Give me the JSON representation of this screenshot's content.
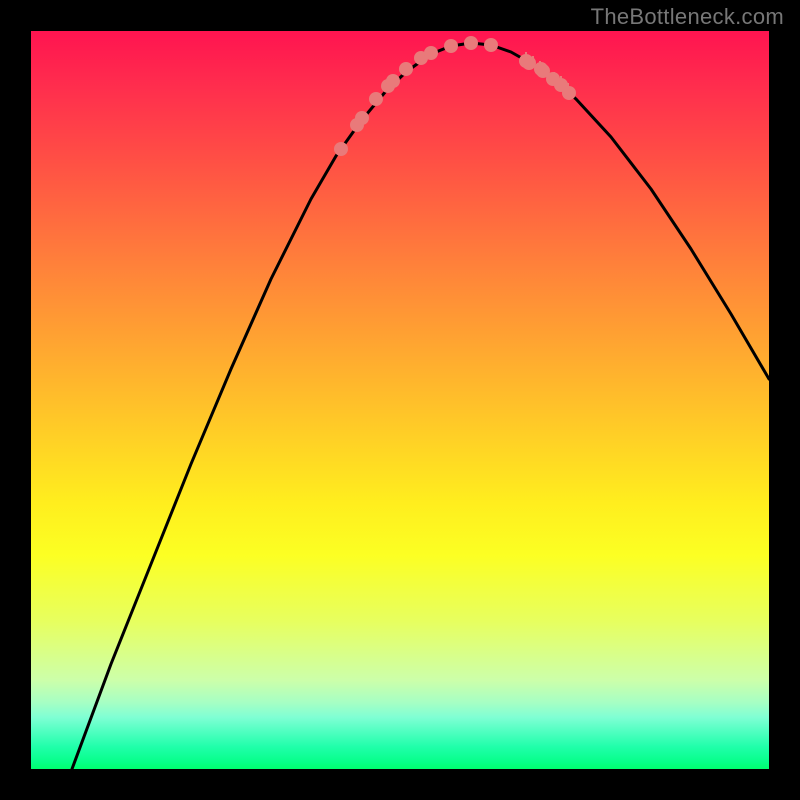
{
  "watermark": "TheBottleneck.com",
  "chart_data": {
    "type": "line",
    "title": "",
    "xlabel": "",
    "ylabel": "",
    "xlim": [
      0,
      738
    ],
    "ylim": [
      0,
      738
    ],
    "grid": false,
    "series": [
      {
        "name": "curve",
        "color": "#000000",
        "x": [
          41,
          80,
          120,
          160,
          200,
          240,
          280,
          305,
          330,
          355,
          375,
          400,
          420,
          440,
          460,
          480,
          510,
          545,
          580,
          620,
          660,
          700,
          738
        ],
        "y": [
          0,
          105,
          205,
          305,
          400,
          490,
          570,
          613,
          648,
          678,
          697,
          715,
          723,
          726,
          724,
          717,
          700,
          670,
          632,
          580,
          520,
          455,
          390
        ]
      }
    ],
    "markers": {
      "name": "dots",
      "color": "#e97a7a",
      "radius": 7,
      "points": [
        [
          310,
          620
        ],
        [
          326,
          644
        ],
        [
          331,
          651
        ],
        [
          345,
          670
        ],
        [
          357,
          683
        ],
        [
          362,
          688
        ],
        [
          375,
          700
        ],
        [
          390,
          711
        ],
        [
          400,
          716
        ],
        [
          420,
          723
        ],
        [
          440,
          726
        ],
        [
          460,
          724
        ],
        [
          495,
          708
        ],
        [
          498,
          706
        ],
        [
          510,
          700
        ],
        [
          512,
          698
        ],
        [
          522,
          690
        ],
        [
          530,
          684
        ],
        [
          538,
          676
        ]
      ],
      "ticks": [
        [
          495,
          708
        ],
        [
          502,
          704
        ],
        [
          509,
          699
        ],
        [
          516,
          694
        ],
        [
          523,
          688
        ],
        [
          530,
          684
        ],
        [
          537,
          677
        ]
      ]
    }
  }
}
